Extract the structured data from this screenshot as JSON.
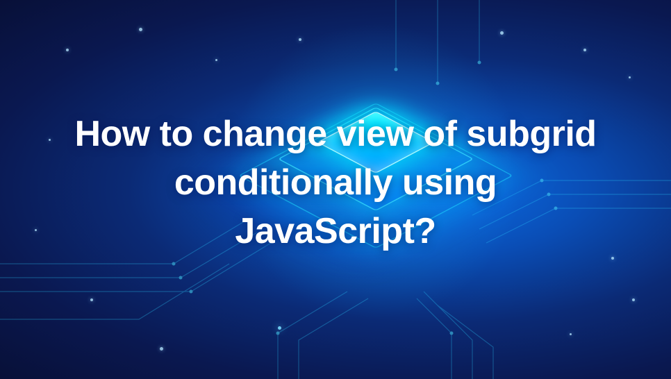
{
  "hero": {
    "title": "How to change view of subgrid conditionally using JavaScript?"
  }
}
